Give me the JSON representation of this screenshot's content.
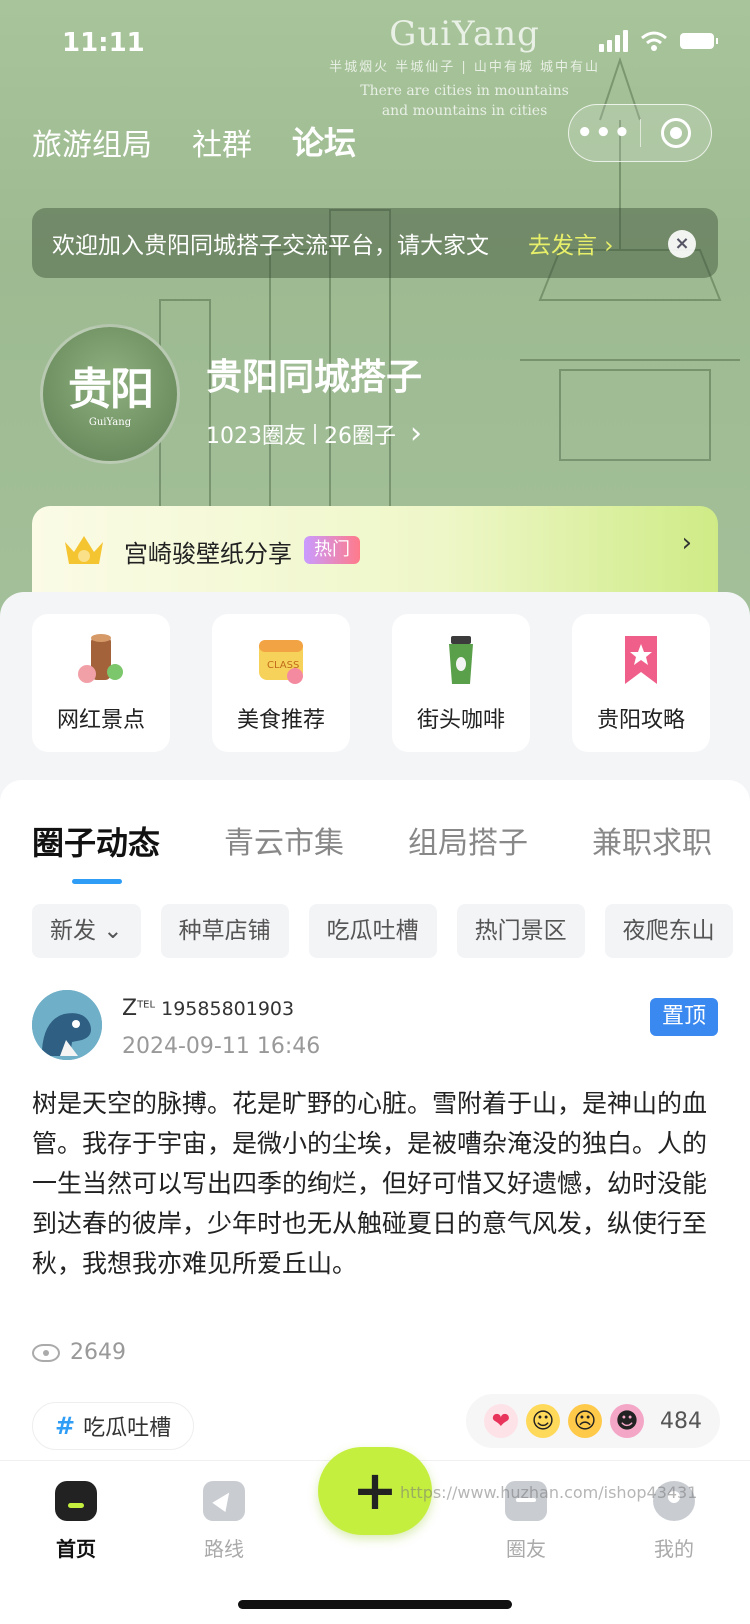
{
  "status": {
    "time": "11:11"
  },
  "hero": {
    "brand_en": "GuiYang",
    "brand_line1": "半城烟火 半城仙子 | 山中有城 城中有山",
    "brand_line2": "There are cities in mountains",
    "brand_line3": "and mountains in cities"
  },
  "topnav": {
    "tabs": [
      "旅游组局",
      "社群",
      "论坛"
    ],
    "active": "论坛"
  },
  "notice": {
    "text": "欢迎加入贵阳同城搭子交流平台，请大家文",
    "action": "去发言 ›",
    "close": "×"
  },
  "community": {
    "avatar_text": "贵阳",
    "avatar_sub": "GuiYang",
    "name": "贵阳同城搭子",
    "members": "1023圈友",
    "circles": "26圈子",
    "arrow": "›"
  },
  "hot": {
    "label": "宫崎骏壁纸分享",
    "badge": "热门",
    "arrow": "›"
  },
  "quick": [
    {
      "label": "网红景点",
      "icon": "tree-stump-icon"
    },
    {
      "label": "美食推荐",
      "icon": "calendar-class-icon"
    },
    {
      "label": "街头咖啡",
      "icon": "coffee-cup-icon"
    },
    {
      "label": "贵阳攻略",
      "icon": "bookmark-star-icon"
    }
  ],
  "feed_tabs": [
    "圈子动态",
    "青云市集",
    "组局搭子",
    "兼职求职"
  ],
  "chips": [
    "新发 ⌄",
    "种草店铺",
    "吃瓜吐槽",
    "热门景区",
    "夜爬东山"
  ],
  "post": {
    "author": "Z",
    "author_tel": "TEL",
    "author_phone": "19585801903",
    "date": "2024-09-11 16:46",
    "pin": "置顶",
    "body": "树是天空的脉搏。花是旷野的心脏。雪附着于山，是神山的血管。我存于宇宙，是微小的尘埃，是被嘈杂淹没的独白。人的一生当然可以写出四季的绚烂，但好可惜又好遗憾，幼时没能到达春的彼岸，少年时也无从触碰夏日的意气风发，纵使行至秋，我想我亦难见所爱丘山。",
    "views": "2649",
    "tag_hash": "#",
    "tag": "吃瓜吐槽",
    "reaction_count": "484"
  },
  "tabbar": {
    "items": [
      {
        "label": "首页",
        "icon": "home-icon"
      },
      {
        "label": "路线",
        "icon": "route-icon"
      },
      {
        "label": "圈友",
        "icon": "chat-icon"
      },
      {
        "label": "我的",
        "icon": "profile-icon"
      }
    ],
    "plus": "+",
    "watermark": "https://www.huzhan.com/ishop43431"
  },
  "colors": {
    "accent_green": "#c5ef3f",
    "accent_blue": "#2f9df5",
    "pin_blue": "#3a89f0"
  }
}
